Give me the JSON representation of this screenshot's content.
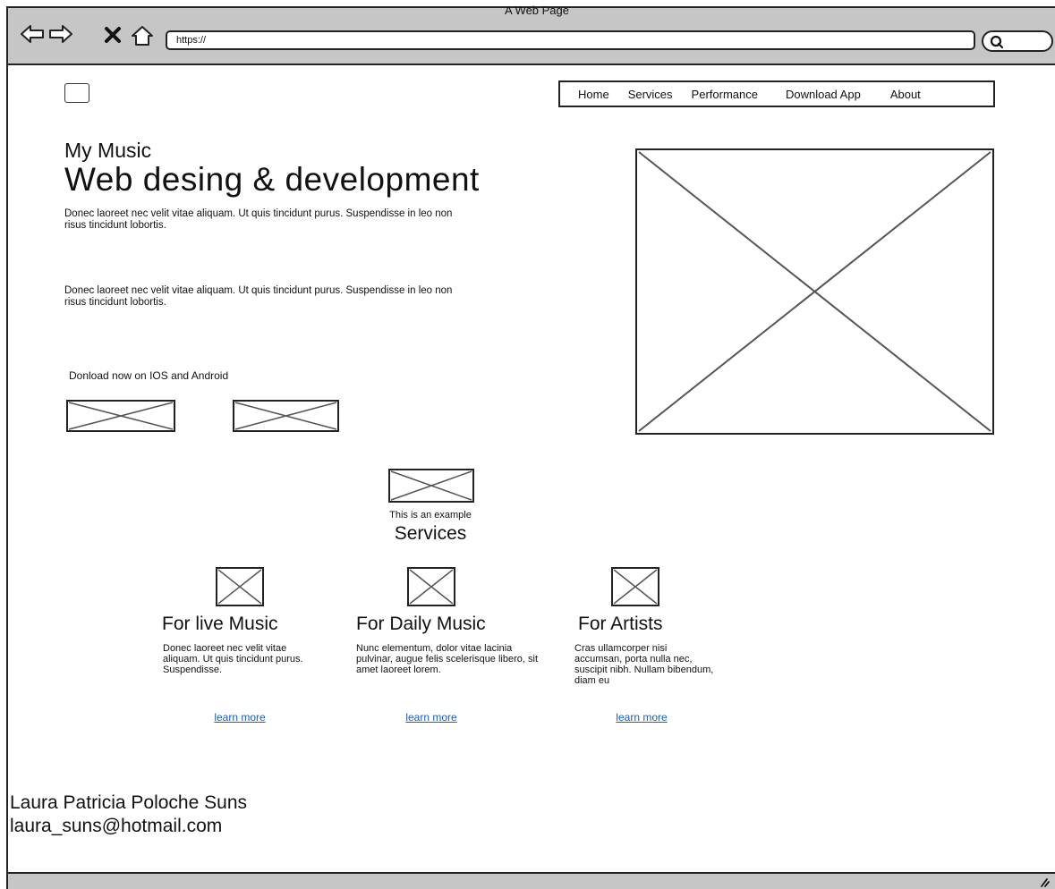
{
  "window": {
    "title": "A Web Page",
    "url": "https://"
  },
  "toolbar_icons": [
    "back-arrow-icon",
    "forward-arrow-icon",
    "close-x-icon",
    "home-icon",
    "search-icon"
  ],
  "nav": {
    "items": [
      "Home",
      "Services",
      "Performance",
      "Download App",
      "About"
    ]
  },
  "hero": {
    "kicker": "My Music",
    "title": "Web desing & development",
    "paragraph_1": "Donec laoreet nec velit vitae aliquam. Ut quis tincidunt purus. Suspendisse in leo non risus tincidunt lobortis.",
    "paragraph_2": "Donec laoreet nec velit vitae aliquam. Ut quis tincidunt purus. Suspendisse in leo non risus tincidunt lobortis.",
    "download_label": "Donload now on IOS and Android"
  },
  "example": {
    "caption": "This is an example",
    "heading": "Services"
  },
  "services": [
    {
      "title": "For live Music",
      "desc": "Donec laoreet nec velit vitae aliquam. Ut quis tincidunt purus. Suspendisse.",
      "link": "learn more"
    },
    {
      "title": "For Daily Music",
      "desc": "Nunc elementum, dolor vitae lacinia pulvinar, augue felis scelerisque libero, sit amet laoreet lorem.",
      "link": "learn more"
    },
    {
      "title": "For Artists",
      "desc": "Cras ullamcorper nisi accumsan, porta nulla nec, suscipit nibh. Nullam bibendum, diam eu",
      "link": "learn more"
    }
  ],
  "footer": {
    "name": "Laura Patricia Poloche Suns",
    "email": "laura_suns@hotmail.com"
  },
  "colors": {
    "chrome": "#c6c6c6",
    "link": "#1c5fb4",
    "stroke": "#222222"
  }
}
